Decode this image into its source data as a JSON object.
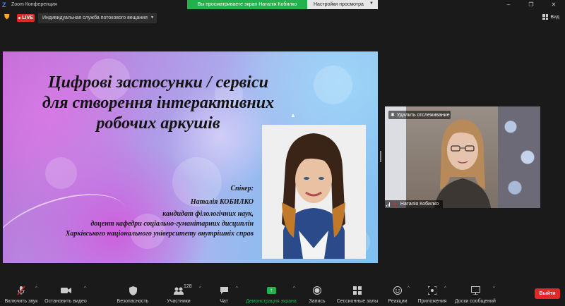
{
  "window": {
    "app_icon": "Z",
    "title": "Zoom Конференция",
    "share_banner": "Вы просматриваете экран Наталія Кобилко",
    "view_settings": "Настройки просмотра",
    "controls": {
      "minimize": "–",
      "maximize": "❐",
      "close": "✕"
    }
  },
  "topbar": {
    "live_label": "LIVE",
    "stream_service": "Индивидуальная служба потокового вещания",
    "view_label": "Вид"
  },
  "slide": {
    "title_lines": [
      "Цифрові застосунки / сервіси",
      "для створення інтерактивних",
      "робочих аркушів"
    ],
    "speaker_label": "Спікер:",
    "speaker_name": "Наталія КОБИЛКО",
    "degree": "кандидат філологічних наук,",
    "position": "доцент кафедри соціально-гуманітарних дисциплін",
    "university": "Харківського національного університету внутрішніх справ"
  },
  "video": {
    "untrack_label": "Удалить отслеживание",
    "participant_name": "Наталія Кобилко"
  },
  "toolbar": {
    "items": [
      {
        "label": "Включить звук",
        "icon": "mic-muted-icon"
      },
      {
        "label": "Остановить видео",
        "icon": "video-camera-icon"
      },
      {
        "label": "Безопасность",
        "icon": "shield-icon"
      },
      {
        "label": "Участники",
        "icon": "participants-icon",
        "count": "128"
      },
      {
        "label": "Чат",
        "icon": "chat-icon"
      },
      {
        "label": "Демонстрация экрана",
        "icon": "share-screen-icon"
      },
      {
        "label": "Запись",
        "icon": "record-icon"
      },
      {
        "label": "Сессионные залы",
        "icon": "breakout-rooms-icon"
      },
      {
        "label": "Реакции",
        "icon": "reactions-icon"
      },
      {
        "label": "Приложения",
        "icon": "apps-icon"
      },
      {
        "label": "Доски сообщений",
        "icon": "whiteboard-icon"
      }
    ],
    "leave_label": "Выйти"
  },
  "colors": {
    "accent_green": "#23b14d",
    "live_red": "#e02828",
    "background": "#1a1a1a"
  }
}
